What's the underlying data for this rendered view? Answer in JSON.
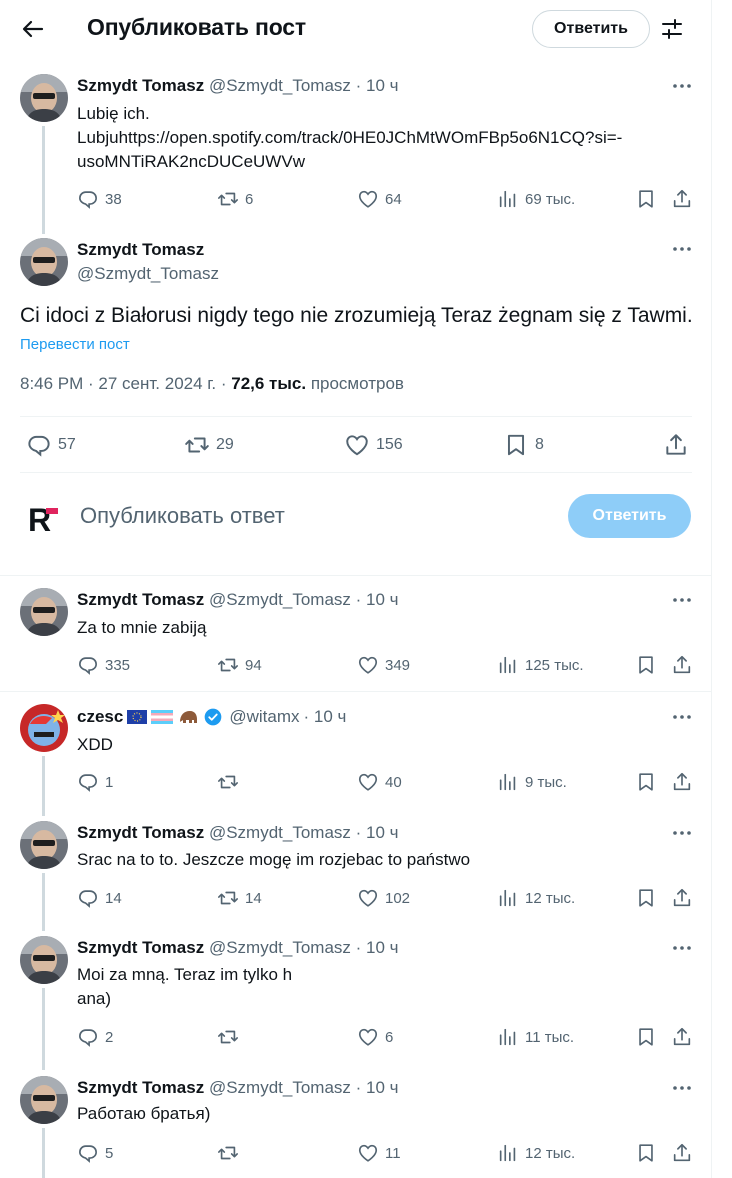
{
  "header": {
    "title": "Опубликовать пост",
    "reply_button": "Ответить"
  },
  "parent_tweet": {
    "name": "Szmydt Tomasz",
    "handle": "@Szmydt_Tomasz",
    "time": "· 10 ч",
    "text_line1": "Lubię ich.",
    "text_line2": "Lubjuhttps://open.spotify.com/track/0HE0JChMtWOmFBp5o6N1CQ?si=-",
    "text_line3": "usoMNTiRAK2ncDUCeUWVw",
    "replies": "38",
    "reposts": "6",
    "likes": "64",
    "views": "69 тыс."
  },
  "main_tweet": {
    "name": "Szmydt Tomasz",
    "handle": "@Szmydt_Tomasz",
    "text": "Ci  idoci z Białorusi nigdy  tego nie zrozumieją  Teraz żegnam się z  Tawmi.",
    "translate": "Перевести пост",
    "meta_time": "8:46 PM · 27 сент. 2024 г. · ",
    "meta_views": "72,6 тыс.",
    "meta_views_label": " просмотров",
    "replies": "57",
    "reposts": "29",
    "likes": "156",
    "bookmarks": "8"
  },
  "compose": {
    "placeholder": "Опубликовать ответ",
    "button": "Ответить",
    "logo_text": "R"
  },
  "replies": [
    {
      "name": "Szmydt Tomasz",
      "handle": "@Szmydt_Tomasz",
      "time": "· 10 ч",
      "line1": "Za to mnie zabiją",
      "line2": "",
      "replies": "335",
      "reposts": "94",
      "likes": "349",
      "views": "125 тыс."
    },
    {
      "name": "czesc",
      "handle": "@witamx",
      "time": "· 10 ч",
      "line1": "XDD",
      "line2": "",
      "replies": "1",
      "reposts": "",
      "likes": "40",
      "views": "9 тыс."
    },
    {
      "name": "Szmydt Tomasz",
      "handle": "@Szmydt_Tomasz",
      "time": "· 10 ч",
      "line1": "Srac na to to. Jeszcze mogę im rozjebac to państwo",
      "line2": "",
      "replies": "14",
      "reposts": "14",
      "likes": "102",
      "views": "12 тыс."
    },
    {
      "name": "Szmydt Tomasz",
      "handle": "@Szmydt_Tomasz",
      "time": "· 10 ч",
      "line1": "Moi za mną. Teraz im tylko h",
      "line2": "ana)",
      "replies": "2",
      "reposts": "",
      "likes": "6",
      "views": "11 тыс."
    },
    {
      "name": "Szmydt Tomasz",
      "handle": "@Szmydt_Tomasz",
      "time": "· 10 ч",
      "line1": "Работаю братья)",
      "line2": "",
      "replies": "5",
      "reposts": "",
      "likes": "11",
      "views": "12 тыс."
    }
  ],
  "colors": {
    "accent": "#1d9bf0",
    "muted": "#536471",
    "button_disabled": "#8ecdf8",
    "border": "#eff3f4"
  }
}
